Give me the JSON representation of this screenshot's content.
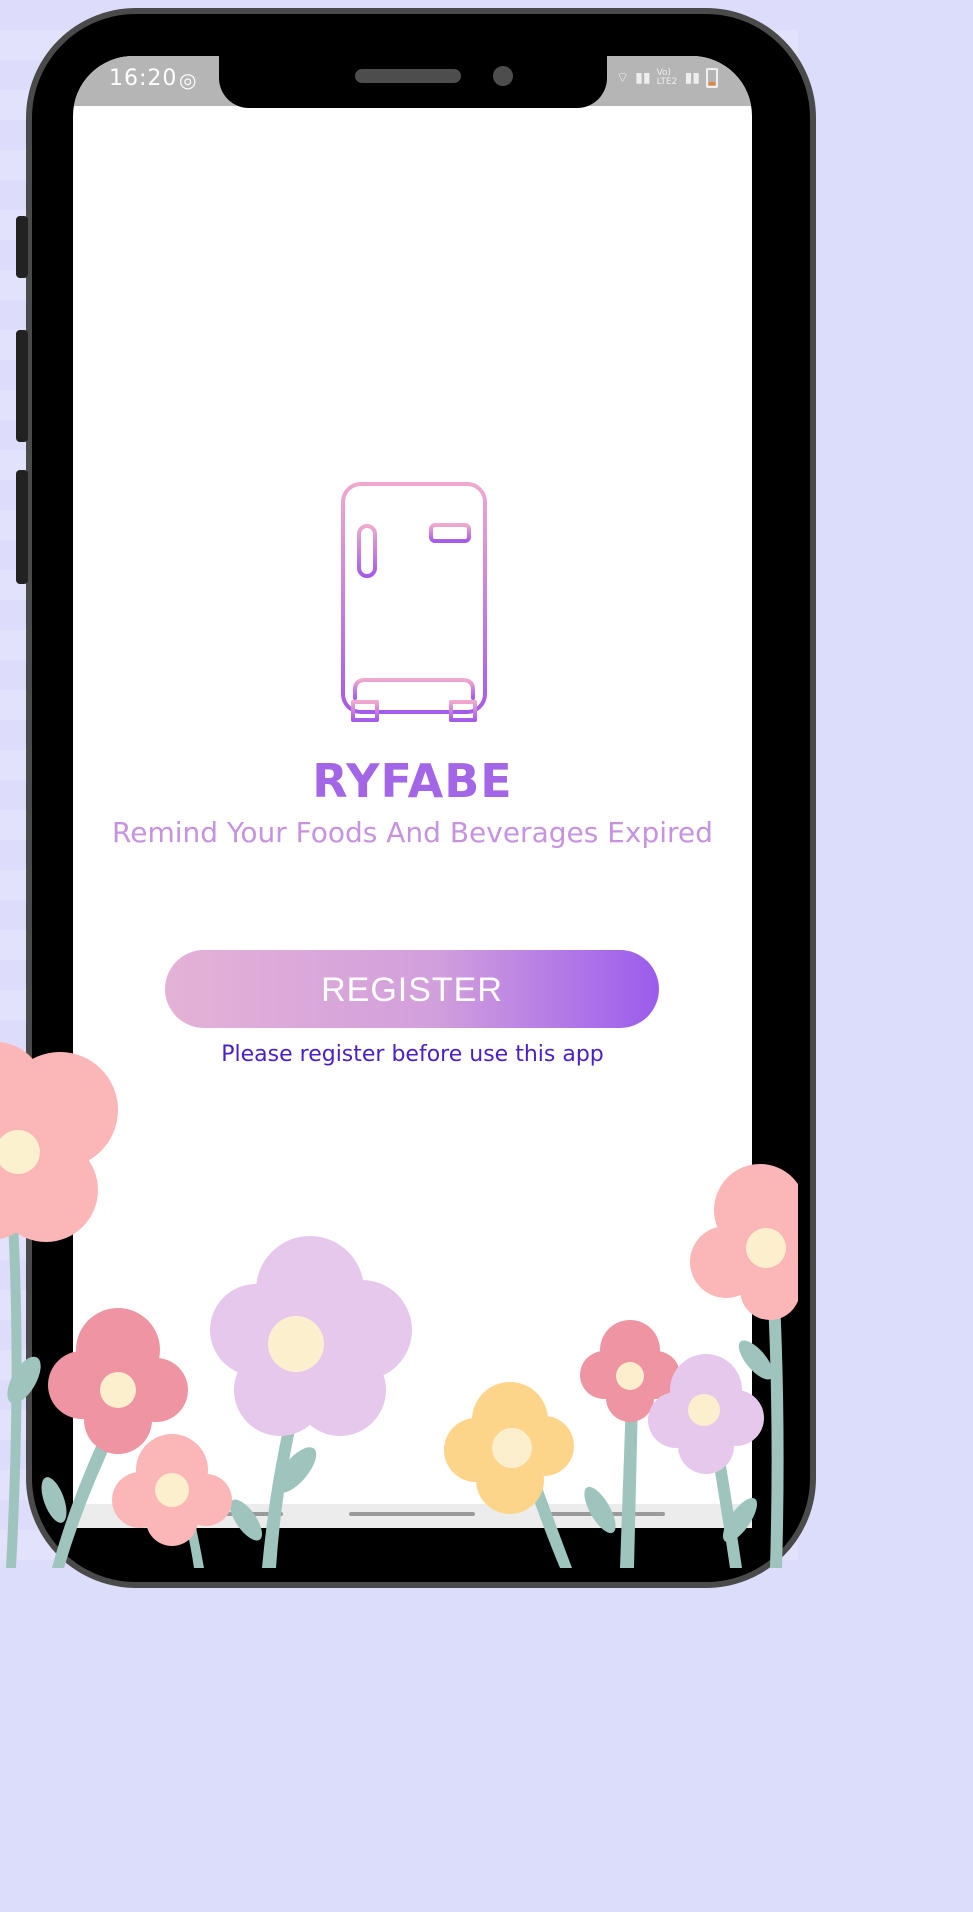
{
  "status_bar": {
    "time": "16:20",
    "network_label": "Vo) LTE2"
  },
  "app": {
    "name": "RYFABE",
    "tagline": "Remind Your Foods And Beverages Expired",
    "register_label": "REGISTER",
    "register_hint": "Please register before use this app"
  },
  "icons": {
    "logo": "fridge-icon"
  },
  "colors": {
    "title": "#a266e6",
    "tagline": "#c793e0",
    "hint": "#4a1fc9",
    "button_start": "#e4b2d6",
    "button_end": "#9b5cec"
  }
}
